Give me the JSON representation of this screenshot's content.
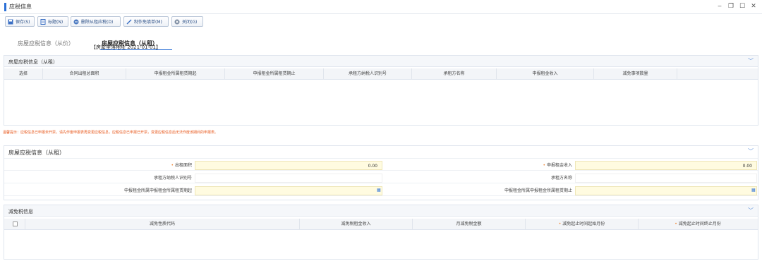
{
  "window": {
    "title": "应税信息",
    "controls": [
      "minimize-icon",
      "restore-icon",
      "maximize-icon",
      "close-icon"
    ]
  },
  "toolbar": {
    "buttons": [
      {
        "label": "保存(S)",
        "icon": "save-icon"
      },
      {
        "label": "标题(N)",
        "icon": "doc-icon"
      },
      {
        "label": "删除从租应税(D)",
        "icon": "delete-icon"
      },
      {
        "label": "制作免填单(M)",
        "icon": "edit-icon"
      },
      {
        "label": "关闭(G)",
        "icon": "close-circle-icon"
      }
    ]
  },
  "tabs": [
    {
      "label": "房屋应税信息（从价）"
    },
    {
      "label": "房屋应税信息（从租）"
    }
  ],
  "overlay_text": "【房屋坐落地址 2021-01-01】",
  "rent_panel": {
    "title": "房屋应税信息（从租）",
    "columns": [
      "选择",
      "合同出租总面积",
      "申报租金所属租赁期起",
      "申报租金所属租赁期止",
      "承租方纳税人识别号",
      "承租方名称",
      "申报租金收入",
      "减免事项数量"
    ]
  },
  "warning": "温馨提示：应税信息已申报未开票，请先作废申报表再变更应税信息，应税信息已申报已开票，变更应税信息后无法作废该期间的申报表。",
  "detail_panel": {
    "title": "房屋应税信息（从租）",
    "fields": {
      "area_label": "出租面积",
      "area_value": "0.00",
      "income_label": "申报租金收入",
      "income_value": "0.00",
      "tenant_id_label": "承租方纳税人识别号",
      "tenant_name_label": "承租方名称",
      "period_start_label": "申报租金所属申报租金所属租赁期起",
      "period_end_label": "申报租金所属申报租金所属租赁期止"
    }
  },
  "relief_panel": {
    "title": "减免税信息",
    "columns": [
      "减免性质代码",
      "减免税租金收入",
      "月减免税金额",
      "减免起止时间起始月份",
      "减免起止时间终止月份"
    ]
  }
}
